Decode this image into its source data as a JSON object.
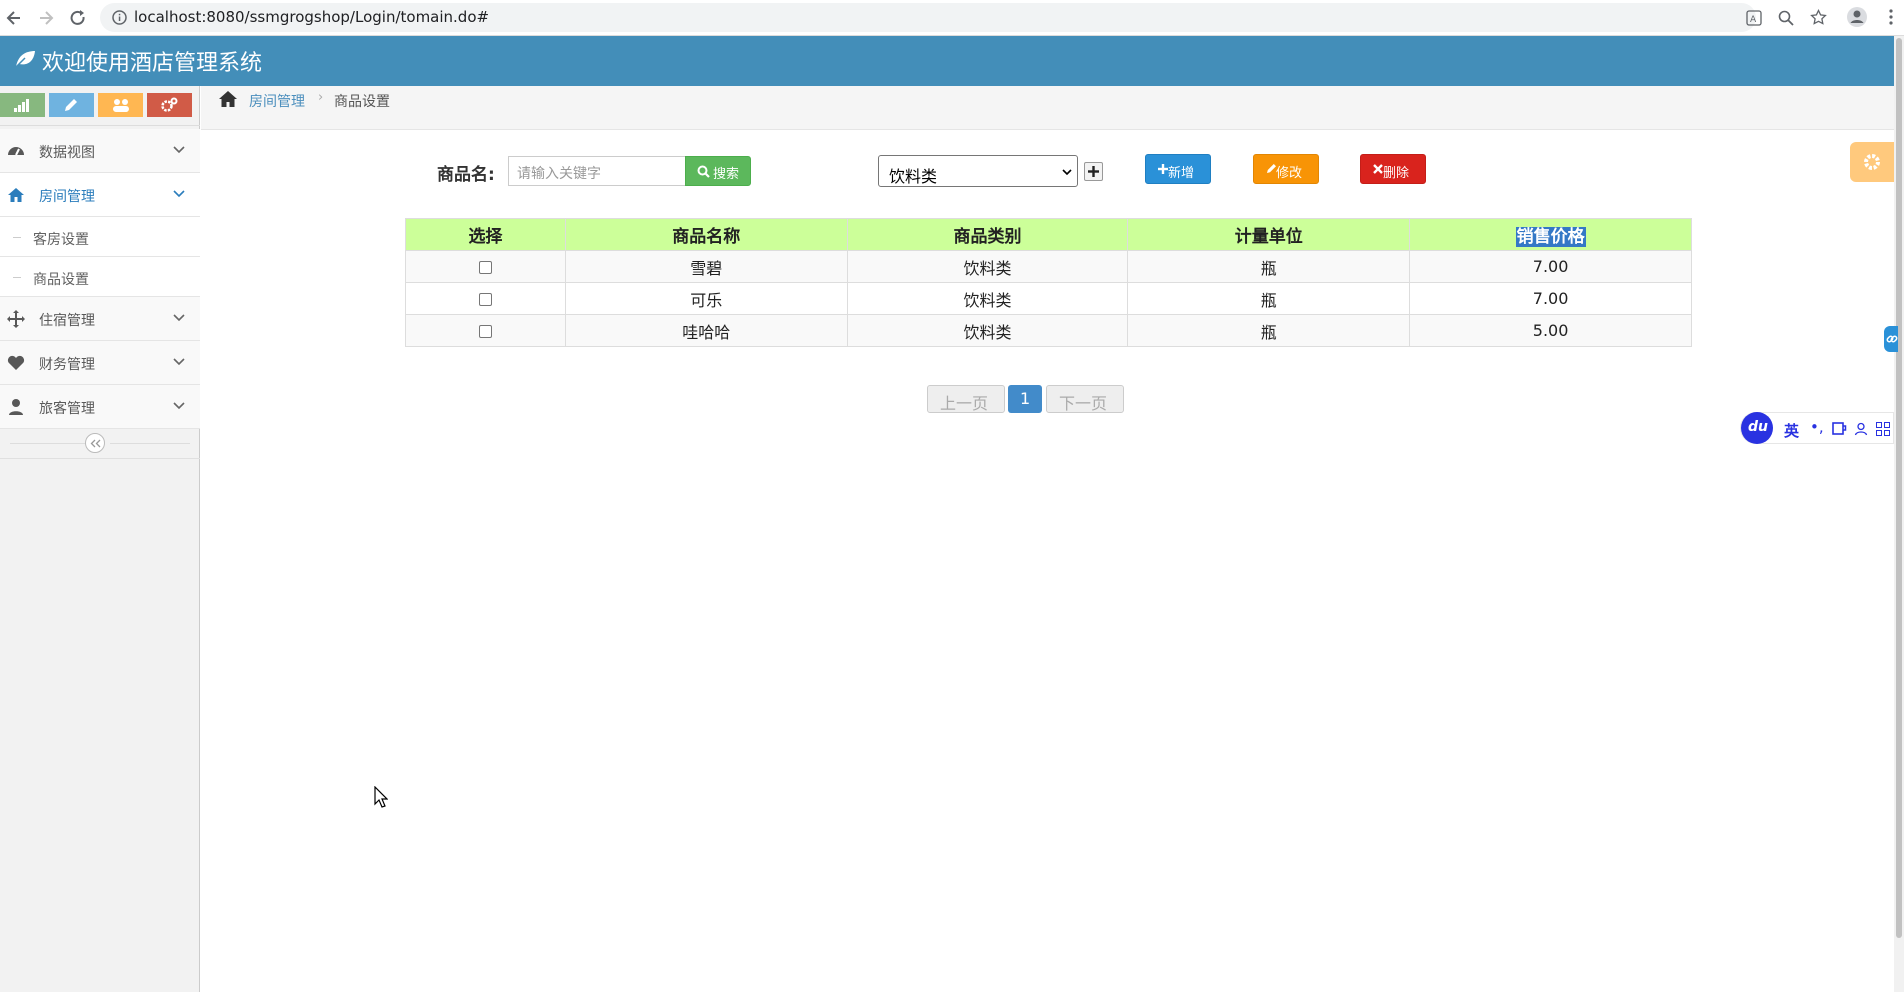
{
  "browser": {
    "url": "localhost:8080/ssmgrogshop/Login/tomain.do#"
  },
  "app": {
    "title": "欢迎使用酒店管理系统"
  },
  "sidebar": {
    "shortcuts": [
      {
        "icon": "signal-icon",
        "color": "#87b87f"
      },
      {
        "icon": "pencil-icon",
        "color": "#6fb3e0"
      },
      {
        "icon": "group-icon",
        "color": "#ffb752"
      },
      {
        "icon": "cogs-icon",
        "color": "#d15b47"
      }
    ],
    "items": [
      {
        "label": "数据视图",
        "icon": "dashboard-icon"
      },
      {
        "label": "房间管理",
        "icon": "home-icon",
        "active": true,
        "children": [
          {
            "label": "客房设置"
          },
          {
            "label": "商品设置"
          }
        ]
      },
      {
        "label": "住宿管理",
        "icon": "move-icon"
      },
      {
        "label": "财务管理",
        "icon": "heart-icon"
      },
      {
        "label": "旅客管理",
        "icon": "user-icon"
      }
    ],
    "collapse_icon": "double-chevron-left-icon"
  },
  "breadcrumb": {
    "home_icon": "home-icon",
    "parent": "房间管理",
    "current": "商品设置"
  },
  "toolbar": {
    "search_label": "商品名:",
    "search_placeholder": "请输入关键字",
    "search_button": "搜索",
    "category_selected": "饮料类",
    "add_label": "新增",
    "edit_label": "修改",
    "delete_label": "删除"
  },
  "table": {
    "headers": [
      "选择",
      "商品名称",
      "商品类别",
      "计量单位",
      "销售价格"
    ],
    "rows": [
      {
        "name": "雪碧",
        "category": "饮料类",
        "unit": "瓶",
        "price": "7.00"
      },
      {
        "name": "可乐",
        "category": "饮料类",
        "unit": "瓶",
        "price": "7.00"
      },
      {
        "name": "哇哈哈",
        "category": "饮料类",
        "unit": "瓶",
        "price": "5.00"
      }
    ]
  },
  "pagination": {
    "prev": "上一页",
    "current": "1",
    "next": "下一页"
  },
  "ime": {
    "lang": "英"
  },
  "colors": {
    "header": "#438eb9",
    "table_header": "#ccff99",
    "search_btn": "#5cb85c",
    "add_btn": "#2a91d8",
    "edit_btn": "#f89406",
    "delete_btn": "#d9231d",
    "settings_btn": "#ffb752"
  }
}
